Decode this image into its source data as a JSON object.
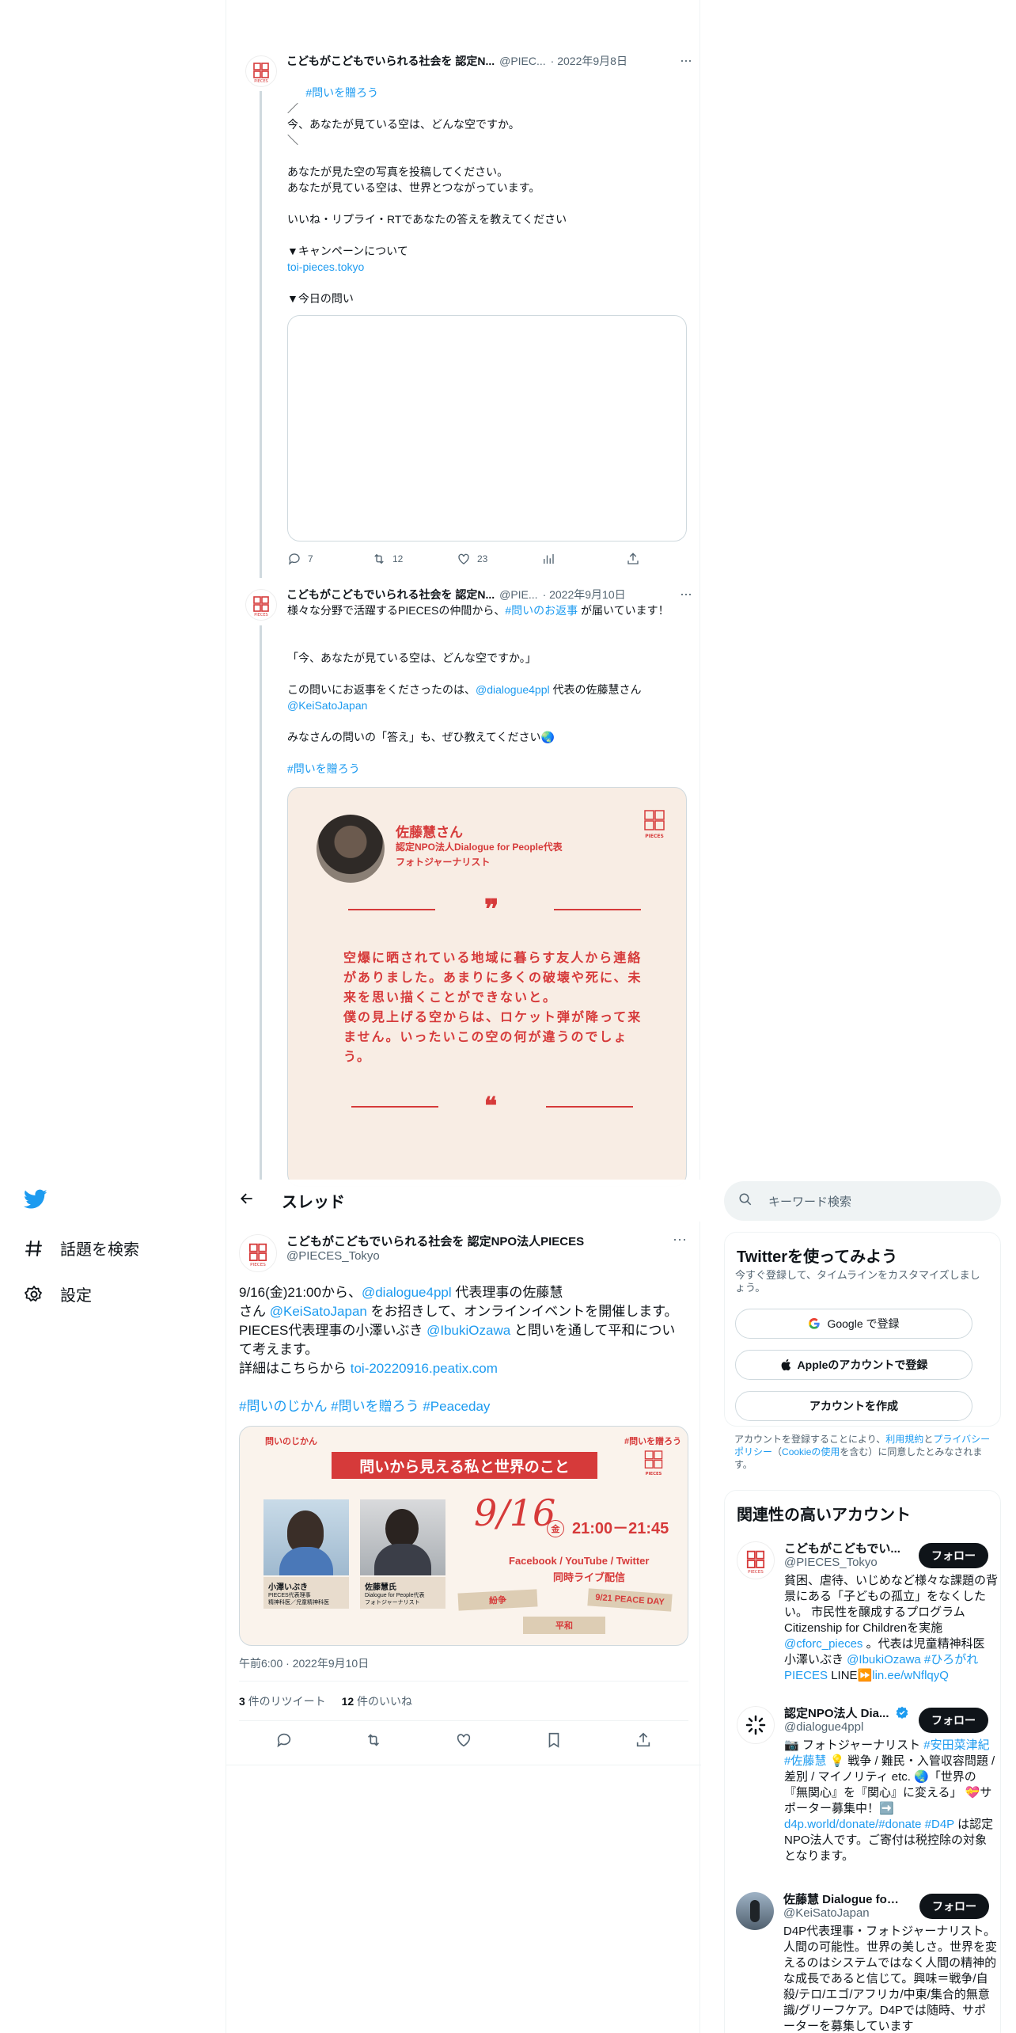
{
  "nav": {
    "explore": "話題を検索",
    "settings": "設定"
  },
  "colors": {
    "accent": "#1d9bf0",
    "pieces_red": "#d63a3a"
  },
  "top_tweet": {
    "name": "こどもがこどもでいられる社会を 認定N...",
    "handle": "@PIEC...",
    "date": "· 2022年9月8日",
    "reply_tag": "#問いを贈ろう",
    "body1": "／\n今、あなたが見ている空は、どんな空ですか。\n＼\n\nあなたが見た空の写真を投稿してください。\nあなたが見ている空は、世界とつながっています。\n\nいいね・リプライ・RTであなたの答えを教えてください\n\n▼キャンペーンについて",
    "link": "toi-pieces.tokyo",
    "body2": "▼今日の問い",
    "replies": "7",
    "retweets": "12",
    "likes": "23"
  },
  "second_tweet": {
    "name": "こどもがこどもでいられる社会を 認定N...",
    "handle": "@PIE...",
    "date": "· 2022年9月10日",
    "text_a": "様々な分野で活躍するPIECESの仲間から、",
    "hashtag_a": "#問いのお返事",
    "text_b": " が届いています！",
    "text_c": "「今、あなたが見ている空は、どんな空ですか。」",
    "text_d": "この問いにお返事をくださったのは、",
    "mention_a": "@dialogue4ppl",
    "text_e": " 代表の佐藤慧さん",
    "mention_b": "@KeiSatoJapan",
    "text_f": "みなさんの問いの「答え」も、ぜひ教えてください🌏",
    "hashtag_b": "#問いを贈ろう",
    "card": {
      "person": "佐藤慧さん",
      "org": "認定NPO法人Dialogue for People代表",
      "role": "フォトジャーナリスト",
      "quote": "空爆に晒されている地域に暮らす友人から連絡がありました。あまりに多くの破壊や死に、未来を思い描くことができないと。\n僕の見上げる空からは、ロケット弾が降って来ません。いったいこの空の何が違うのでしょう。",
      "logo_text": "PIECES"
    }
  },
  "header": {
    "title": "スレッド"
  },
  "main_tweet": {
    "name": "こどもがこどもでいられる社会を 認定NPO法人PIECES",
    "handle": "@PIECES_Tokyo",
    "line1a": "9/16(金)21:00から、",
    "line1m": "@dialogue4ppl",
    "line1b": " 代表理事の佐藤慧",
    "line2a": "さん ",
    "line2m": "@KeiSatoJapan",
    "line2b": " をお招きして、オンラインイベントを開催します。",
    "line3a": "PIECES代表理事の小澤いぶき ",
    "line3m": "@IbukiOzawa",
    "line3b": " と問いを通して平和につい",
    "line4": "て考えます。",
    "line5a": "詳細はこちらから ",
    "line5l": "toi-20220916.peatix.com",
    "tags": "#問いのじかん #問いを贈ろう #Peaceday",
    "event": {
      "corner_left": "問いのじかん",
      "corner_right": "#問いを贈ろう",
      "banner": "問いから見える私と世界のこと",
      "p1_name": "小澤いぶき",
      "p1_role": "PIECES代表理事\n精神科医／児童精神科医",
      "p2_name": "佐藤慧氏",
      "p2_role": "Dialogue for People代表\nフォトジャーナリスト",
      "date": "9/16",
      "weekday": "金",
      "time": "21:00－21:45",
      "platforms": "Facebook / YouTube / Twitter",
      "live": "同時ライブ配信",
      "tag1": "紛争",
      "tag2": "9/21 PEACE DAY",
      "tag3": "平和",
      "logo_text": "PIECES"
    },
    "timestamp": "午前6:00 · 2022年9月10日",
    "retweet_count": "3",
    "retweet_label": " 件のリツイート",
    "like_count": "12",
    "like_label": " 件のいいね"
  },
  "search": {
    "placeholder": "キーワード検索"
  },
  "signup": {
    "title": "Twitterを使ってみよう",
    "subtitle": "今すぐ登録して、タイムラインをカスタマイズしましょう。",
    "google": "Google で登録",
    "apple": "Appleのアカウントで登録",
    "create": "アカウントを作成",
    "legal_a": "アカウントを登録することにより、",
    "legal_terms": "利用規約",
    "legal_b": "と",
    "legal_privacy": "プライバシーポリシー",
    "legal_c": "（",
    "legal_cookie": "Cookieの使用",
    "legal_d": "を含む）に同意したとみなされます。"
  },
  "related": {
    "title": "関連性の高いアカウント",
    "follow": "フォロー",
    "accounts": [
      {
        "name": "こどもがこどもでい...",
        "handle": "@PIECES_Tokyo",
        "bio_a": "貧困、虐待、いじめなど様々な課題の背景にある「子どもの孤立」をなくしたい。 市民性を醸成するプログラム Citizenship for Childrenを実施 ",
        "bio_m1": "@cforc_pieces",
        "bio_b": " 。代表は児童精神科医 小澤いぶき ",
        "bio_m2": "@IbukiOzawa #ひろがれPIECES",
        "bio_c": " LINE⏩",
        "bio_link": "lin.ee/wNflqyQ"
      },
      {
        "name": "認定NPO法人 Dia...",
        "handle": "@dialogue4ppl",
        "bio_a": "📷 フォトジャーナリスト ",
        "bio_m1": "#安田菜津紀 #佐藤慧",
        "bio_b": " 💡 戦争 / 難民・入管収容問題 / 差別 / マイノリティ etc. 🌏「世界の『無関心』を『関心』に変える」 💝サポーター募集中！➡️ ",
        "bio_m2": "d4p.world/donate/#donate #D4P",
        "bio_c": " は認定NPO法人です。ご寄付は税控除の対象となります。",
        "bio_link": ""
      },
      {
        "name": "佐藤慧 Dialogue for ...",
        "handle": "@KeiSatoJapan",
        "bio_a": "D4P代表理事・フォトジャーナリスト。人間の可能性。世界の美しさ。世界を変えるのはシステムではなく人間の精神的な成長であると信じて。興味＝戦争/自殺/テロ/エゴ/アフリカ/中東/集合的無意識/グリーフケア。D4Pでは随時、サポーターを募集しています",
        "bio_m1": "",
        "bio_b": "",
        "bio_m2": "",
        "bio_c": "",
        "bio_link": ""
      }
    ]
  }
}
